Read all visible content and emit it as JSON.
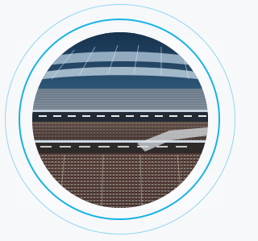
{
  "image": {
    "subject": "stadium-photo",
    "accent_ring_color": "#17b3e6",
    "outer_ring_color": "#8fd8ef",
    "background_color": "#f7f8fa"
  }
}
